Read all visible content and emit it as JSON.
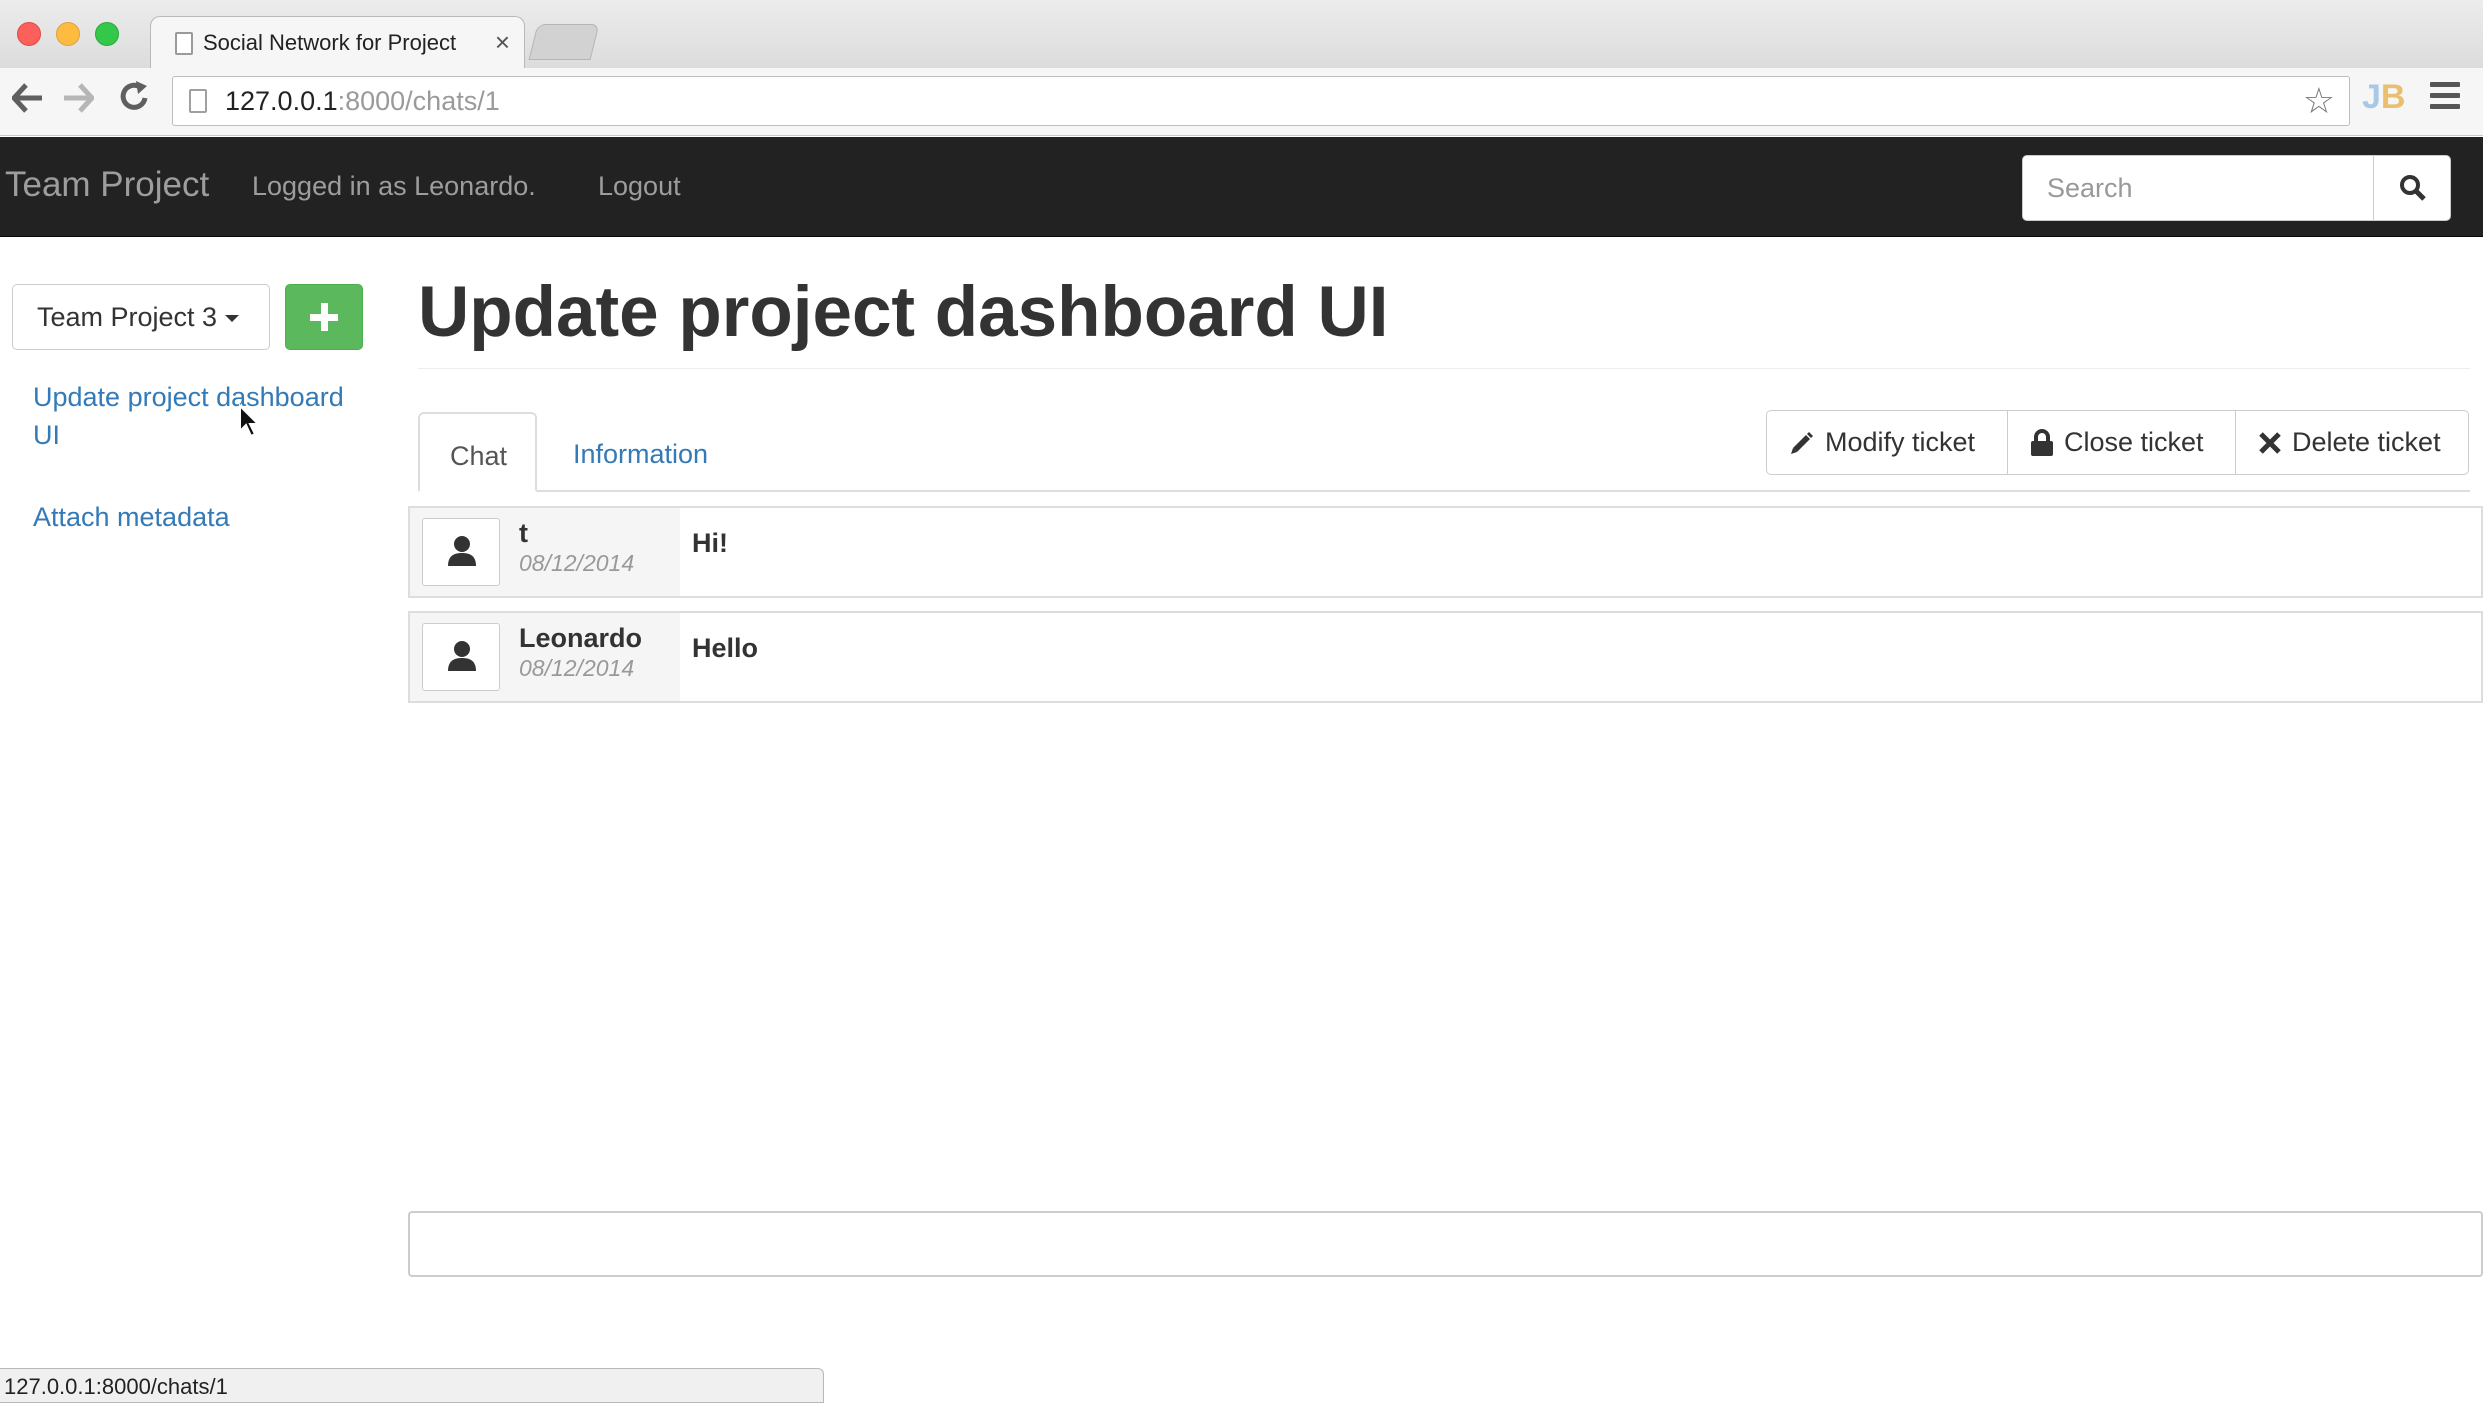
{
  "browser": {
    "tab_title": "Social Network for Project",
    "tab_close": "×",
    "url_host": "127.0.0.1",
    "url_path": ":8000/chats/1",
    "extension_label": "JB"
  },
  "navbar": {
    "brand": "Team Project",
    "logged_in_text": "Logged in as Leonardo.",
    "logout": "Logout",
    "search_placeholder": "Search"
  },
  "sidebar": {
    "project_select": "Team Project 3",
    "tickets": [
      {
        "label": "Update project dashboard UI"
      },
      {
        "label": "Attach metadata"
      }
    ]
  },
  "main": {
    "title": "Update project dashboard UI",
    "tabs": [
      {
        "label": "Chat",
        "active": true
      },
      {
        "label": "Information",
        "active": false
      }
    ],
    "actions": {
      "modify": "Modify ticket",
      "close": "Close ticket",
      "delete": "Delete ticket"
    },
    "messages": [
      {
        "user": "t",
        "date": "08/12/2014",
        "text": "Hi!"
      },
      {
        "user": "Leonardo",
        "date": "08/12/2014",
        "text": "Hello"
      }
    ],
    "chat_input_value": ""
  },
  "status_bar": {
    "text": "127.0.0.1:8000/chats/1"
  },
  "colors": {
    "navbar_bg": "#222222",
    "link": "#337ab7",
    "success": "#5cb85c"
  }
}
